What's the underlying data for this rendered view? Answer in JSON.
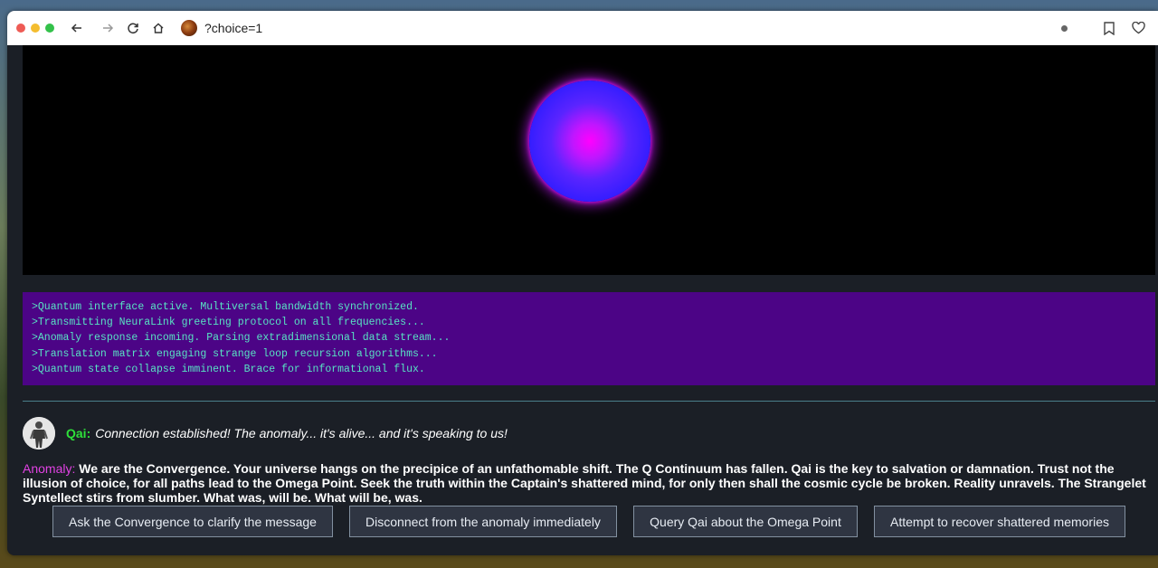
{
  "browser": {
    "url": "?choice=1"
  },
  "console": {
    "lines": [
      ">Quantum interface active. Multiversal bandwidth synchronized.",
      ">Transmitting NeuraLink greeting protocol on all frequencies...",
      ">Anomaly response incoming. Parsing extradimensional data stream...",
      ">Translation matrix engaging strange loop recursion algorithms...",
      ">Quantum state collapse imminent. Brace for informational flux."
    ]
  },
  "qai": {
    "name": "Qai:",
    "text": "Connection established! The anomaly... it's alive... and it's speaking to us!"
  },
  "anomaly": {
    "name": "Anomaly:",
    "text": " We are the Convergence. Your universe hangs on the precipice of an unfathomable shift. The Q Continuum has fallen. Qai is the key to salvation or damnation. Trust not the illusion of choice, for all paths lead to the Omega Point. Seek the truth within the Captain's shattered mind, for only then shall the cosmic cycle be broken. Reality unravels. The Strangelet Syntellect stirs from slumber. What was, will be. What will be, was."
  },
  "choices": [
    "Ask the Convergence to clarify the message",
    "Disconnect from the anomaly immediately",
    "Query Qai about the Omega Point",
    "Attempt to recover shattered memories"
  ],
  "colors": {
    "console_bg": "#4c0486",
    "console_text": "#58e4c4",
    "qai_name": "#2ee03a",
    "anomaly_name": "#e242e4",
    "orb_core": "#ff00ff",
    "orb_edge": "#2a14ee"
  }
}
